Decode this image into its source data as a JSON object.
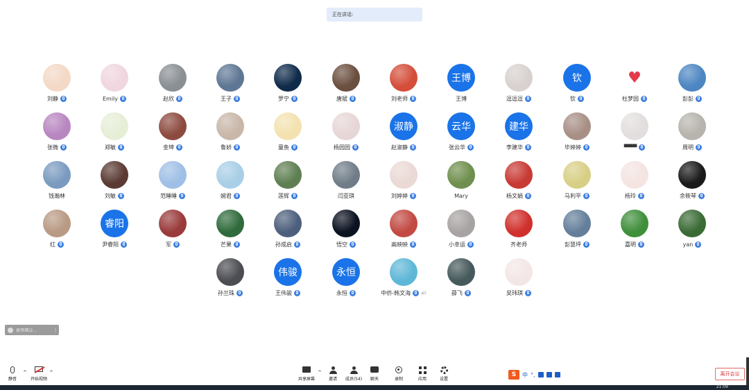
{
  "speaking": {
    "label": "正在讲话:"
  },
  "participants": [
    {
      "name": "刘静",
      "avatar": {
        "type": "photo",
        "color": "#f3d9c6"
      },
      "mic": true
    },
    {
      "name": "Emily",
      "avatar": {
        "type": "photo",
        "color": "#f0d6df"
      },
      "mic": true
    },
    {
      "name": "赵欣",
      "avatar": {
        "type": "photo",
        "color": "#8a8f94"
      },
      "mic": true
    },
    {
      "name": "王子",
      "avatar": {
        "type": "photo",
        "color": "#5e7794"
      },
      "mic": true
    },
    {
      "name": "罗宁",
      "avatar": {
        "type": "photo",
        "color": "#0f2b4a"
      },
      "mic": true
    },
    {
      "name": "唐斌",
      "avatar": {
        "type": "photo",
        "color": "#6b4f3f"
      },
      "mic": true
    },
    {
      "name": "刘老师",
      "avatar": {
        "type": "photo",
        "color": "#d44e3a"
      },
      "mic": true
    },
    {
      "name": "王博",
      "avatar": {
        "type": "text",
        "text": "王博"
      },
      "mic": false
    },
    {
      "name": "逗逗逗",
      "avatar": {
        "type": "photo",
        "color": "#d8d1cf"
      },
      "mic": true
    },
    {
      "name": "钦",
      "avatar": {
        "type": "text",
        "text": "钦"
      },
      "mic": true
    },
    {
      "name": "杜梦园",
      "avatar": {
        "type": "heart"
      },
      "mic": true
    },
    {
      "name": "彭彭",
      "avatar": {
        "type": "photo",
        "color": "#4d86c2"
      },
      "mic": true
    },
    {
      "name": "张微",
      "avatar": {
        "type": "photo",
        "color": "#b886c0"
      },
      "mic": true
    },
    {
      "name": "郑敏",
      "avatar": {
        "type": "photo",
        "color": "#e6eed6"
      },
      "mic": true
    },
    {
      "name": "金坤",
      "avatar": {
        "type": "photo",
        "color": "#8d4b40"
      },
      "mic": true
    },
    {
      "name": "鲁娇",
      "avatar": {
        "type": "photo",
        "color": "#c9b7a9"
      },
      "mic": true
    },
    {
      "name": "童鱼",
      "avatar": {
        "type": "photo",
        "color": "#f3e2b0"
      },
      "mic": true
    },
    {
      "name": "杨园园",
      "avatar": {
        "type": "photo",
        "color": "#e7d6d6"
      },
      "mic": true
    },
    {
      "name": "赵淑静",
      "avatar": {
        "type": "text",
        "text": "淑静"
      },
      "mic": true
    },
    {
      "name": "张云华",
      "avatar": {
        "type": "text",
        "text": "云华"
      },
      "mic": true
    },
    {
      "name": "李建华",
      "avatar": {
        "type": "text",
        "text": "建华"
      },
      "mic": true
    },
    {
      "name": "毕婷婷",
      "avatar": {
        "type": "photo",
        "color": "#a88f86"
      },
      "mic": true
    },
    {
      "name": "▀▀▀",
      "avatar": {
        "type": "photo",
        "color": "#e3dede"
      },
      "mic": true
    },
    {
      "name": "周明",
      "avatar": {
        "type": "photo",
        "color": "#b7b4ad"
      },
      "mic": true
    },
    {
      "name": "钱瀚林",
      "avatar": {
        "type": "photo",
        "color": "#7a9bbf"
      },
      "mic": false
    },
    {
      "name": "刘敏",
      "avatar": {
        "type": "photo",
        "color": "#5b3a33"
      },
      "mic": true
    },
    {
      "name": "范睡睡",
      "avatar": {
        "type": "photo",
        "color": "#9fbfe6"
      },
      "mic": true
    },
    {
      "name": "婉君",
      "avatar": {
        "type": "photo",
        "color": "#a8cfe6"
      },
      "mic": true
    },
    {
      "name": "莲辉",
      "avatar": {
        "type": "photo",
        "color": "#5f7f52"
      },
      "mic": true
    },
    {
      "name": "闫亚琪",
      "avatar": {
        "type": "photo",
        "color": "#707d88"
      },
      "mic": false
    },
    {
      "name": "刘婷婷",
      "avatar": {
        "type": "photo",
        "color": "#ead9d5"
      },
      "mic": true
    },
    {
      "name": "Mary",
      "avatar": {
        "type": "photo",
        "color": "#6f8f4e"
      },
      "mic": false
    },
    {
      "name": "杨文娟",
      "avatar": {
        "type": "photo",
        "color": "#c83a34"
      },
      "mic": true
    },
    {
      "name": "马利平",
      "avatar": {
        "type": "photo",
        "color": "#d8cf86"
      },
      "mic": true
    },
    {
      "name": "杨玲",
      "avatar": {
        "type": "photo",
        "color": "#f4e4e2"
      },
      "mic": true
    },
    {
      "name": "余筱琴",
      "avatar": {
        "type": "photo",
        "color": "#1b1a1a"
      },
      "mic": true
    },
    {
      "name": "红",
      "avatar": {
        "type": "photo",
        "color": "#b99a84"
      },
      "mic": true
    },
    {
      "name": "尹睿阳",
      "avatar": {
        "type": "text",
        "text": "睿阳"
      },
      "mic": true
    },
    {
      "name": "军",
      "avatar": {
        "type": "photo",
        "color": "#9a3a3a"
      },
      "mic": true
    },
    {
      "name": "芒果",
      "avatar": {
        "type": "photo",
        "color": "#2f6b3c"
      },
      "mic": true
    },
    {
      "name": "孙成启",
      "avatar": {
        "type": "photo",
        "color": "#4d5f7c"
      },
      "mic": true
    },
    {
      "name": "悟空",
      "avatar": {
        "type": "photo",
        "color": "#0b1220"
      },
      "mic": true
    },
    {
      "name": "高映映",
      "avatar": {
        "type": "photo",
        "color": "#c24a43"
      },
      "mic": true
    },
    {
      "name": "小幸运",
      "avatar": {
        "type": "photo",
        "color": "#a7a3a2"
      },
      "mic": true
    },
    {
      "name": "齐老师",
      "avatar": {
        "type": "photo",
        "color": "#d0302c"
      },
      "mic": false
    },
    {
      "name": "彭慧坪",
      "avatar": {
        "type": "photo",
        "color": "#657f9b"
      },
      "mic": true
    },
    {
      "name": "嘉明",
      "avatar": {
        "type": "photo",
        "color": "#3f8f3b"
      },
      "mic": true
    },
    {
      "name": "yan",
      "avatar": {
        "type": "photo",
        "color": "#3a6b35"
      },
      "mic": true
    },
    {
      "name": "孙兰珠",
      "avatar": {
        "type": "photo",
        "color": "#4b4d52"
      },
      "mic": true
    },
    {
      "name": "王伟骏",
      "avatar": {
        "type": "text",
        "text": "伟骏"
      },
      "mic": true
    },
    {
      "name": "永恒",
      "avatar": {
        "type": "text",
        "text": "永恒"
      },
      "mic": true
    },
    {
      "name": "中侨-韩文海",
      "avatar": {
        "type": "photo",
        "color": "#5fb7d7"
      },
      "mic": true,
      "extra": "◂))"
    },
    {
      "name": "薛飞",
      "avatar": {
        "type": "photo",
        "color": "#46595b"
      },
      "mic": true
    },
    {
      "name": "吴玮琪",
      "avatar": {
        "type": "photo",
        "color": "#f3e7e6"
      },
      "mic": true
    }
  ],
  "minimized_panel": {
    "label": "吴玮琪(2...",
    "sep": "|"
  },
  "toolbar": {
    "mute": "静音",
    "start_video": "开始视频",
    "share_screen": "共享屏幕",
    "invite": "邀请",
    "members": "成员(54)",
    "chat": "聊天",
    "record": "录制",
    "apps": "应用",
    "settings": "设置",
    "caret": "^"
  },
  "ime": {
    "logo": "S",
    "lang": "中",
    "punct": "°,"
  },
  "leave": {
    "label": "离开会议"
  },
  "taskbar": {
    "time": "21:09"
  },
  "colors": {
    "accent": "#1a73e8",
    "mic": "#3d7fe0",
    "leave": "#d23b3b"
  }
}
